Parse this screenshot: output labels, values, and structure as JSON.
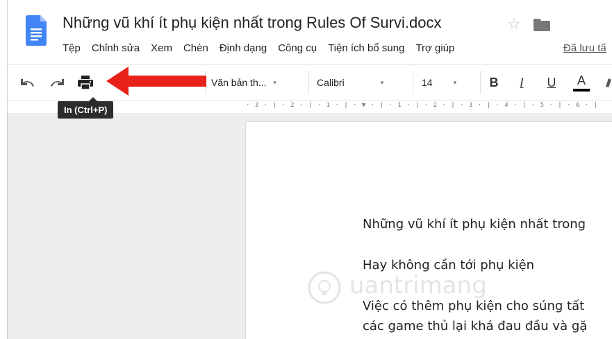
{
  "header": {
    "title": "Những vũ khí ít phụ kiện nhất trong Rules Of Survi.docx",
    "star_symbol": "☆",
    "saved_status": "Đã lưu tấ",
    "menu": [
      "Tệp",
      "Chỉnh sửa",
      "Xem",
      "Chèn",
      "Định dạng",
      "Công cụ",
      "Tiện ích bổ sung",
      "Trợ giúp"
    ]
  },
  "toolbar": {
    "style_value": "Văn bản th...",
    "font_value": "Calibri",
    "size_value": "14",
    "bold_label": "B",
    "italic_label": "I",
    "underline_label": "U",
    "text_color_label": "A",
    "tooltip": "In (Ctrl+P)",
    "caret": "▾"
  },
  "ruler": {
    "text": "· 3 · | · 2 · | · 1 · | · ▼ · | · 1 · | · 2 · | · 3 · | · 4 · | · 5 · | · 6 · |"
  },
  "document": {
    "paragraphs": [
      "Những vũ khí ít phụ kiện nhất trong",
      "Hay không cần tới phụ kiện",
      "Việc có thêm phụ kiện cho súng tất",
      "các game thủ lại khá đau đầu và gặ"
    ]
  },
  "watermark": {
    "text": "uantrimang"
  },
  "colors": {
    "docs_blue": "#4285f4",
    "annotation_red": "#e8221b",
    "tooltip_bg": "#2c2c2c",
    "canvas_bg": "#eeeeee"
  }
}
